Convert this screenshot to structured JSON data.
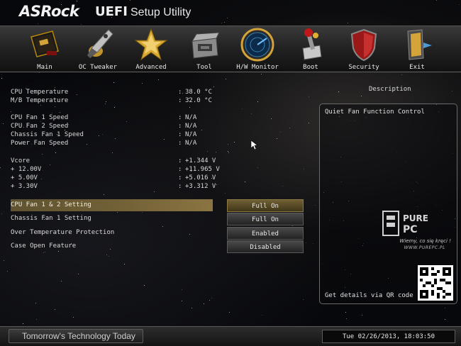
{
  "header": {
    "brand": "ASRock",
    "uefi": "UEFI",
    "subtitle": "Setup Utility"
  },
  "tabs": [
    {
      "label": "Main",
      "icon": "main-card-icon"
    },
    {
      "label": "OC Tweaker",
      "icon": "rocket-icon"
    },
    {
      "label": "Advanced",
      "icon": "star-icon"
    },
    {
      "label": "Tool",
      "icon": "toolbox-icon"
    },
    {
      "label": "H/W Monitor",
      "icon": "radar-icon"
    },
    {
      "label": "Boot",
      "icon": "boot-lever-icon"
    },
    {
      "label": "Security",
      "icon": "shield-icon"
    },
    {
      "label": "Exit",
      "icon": "exit-door-icon"
    }
  ],
  "monitor": {
    "cpu_temp": {
      "label": "CPU Temperature",
      "value": "38.0 °C"
    },
    "mb_temp": {
      "label": "M/B Temperature",
      "value": "32.0 °C"
    },
    "cpu_fan1": {
      "label": "CPU Fan 1 Speed",
      "value": "N/A"
    },
    "cpu_fan2": {
      "label": "CPU Fan 2 Speed",
      "value": "N/A"
    },
    "chassis_fan1": {
      "label": "Chassis Fan 1 Speed",
      "value": "N/A"
    },
    "power_fan": {
      "label": "Power Fan Speed",
      "value": "N/A"
    },
    "vcore": {
      "label": "Vcore",
      "value": "+1.344 V"
    },
    "v12": {
      "label": "+ 12.00V",
      "value": "+11.965 V"
    },
    "v5": {
      "label": "+ 5.00V",
      "value": "+5.016 V"
    },
    "v33": {
      "label": "+ 3.30V",
      "value": "+3.312 V"
    },
    "separator": ":"
  },
  "settings": [
    {
      "label": "CPU Fan 1 & 2 Setting",
      "value": "Full On"
    },
    {
      "label": "Chassis Fan 1 Setting",
      "value": "Full On"
    },
    {
      "label": "Over Temperature Protection",
      "value": "Enabled"
    },
    {
      "label": "Case Open Feature",
      "value": "Disabled"
    }
  ],
  "description": {
    "title": "Description",
    "text": "Quiet Fan Function Control",
    "qr_text": "Get details via QR code"
  },
  "watermark": {
    "logo": "PURE PC",
    "slogan": "Wiemy, co się kręci !",
    "url": "WWW.PUREPC.PL"
  },
  "footer": {
    "slogan": "Tomorrow's Technology Today",
    "datetime": "Tue 02/26/2013, 18:03:50"
  },
  "colors": {
    "selected": "#756338",
    "accent": "#c9a648"
  }
}
